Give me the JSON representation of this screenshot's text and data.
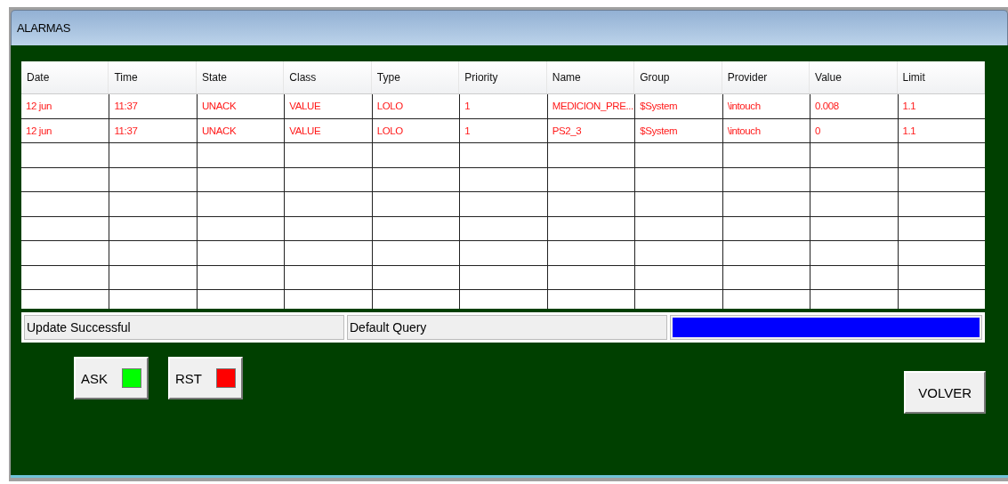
{
  "window": {
    "title": "ALARMAS"
  },
  "table": {
    "columns": [
      "Date",
      "Time",
      "State",
      "Class",
      "Type",
      "Priority",
      "Name",
      "Group",
      "Provider",
      "Value",
      "Limit"
    ],
    "rows": [
      [
        "12 jun",
        "11:37",
        "UNACK",
        "VALUE",
        "LOLO",
        "1",
        "MEDICION_PRE...",
        "$System",
        "\\intouch",
        "0.008",
        "1.1"
      ],
      [
        "12 jun",
        "11:37",
        "UNACK",
        "VALUE",
        "LOLO",
        "1",
        "PS2_3",
        "$System",
        "\\intouch",
        "0",
        "1.1"
      ]
    ]
  },
  "status_bar": {
    "message": "Update Successful",
    "query": "Default Query",
    "progress": {
      "level": 1
    }
  },
  "buttons": [
    {
      "label": "ASK",
      "color": "#00ff00"
    },
    {
      "label": "RST",
      "color": "#ff0000"
    }
  ],
  "back_button": {
    "label": "VOLVER"
  }
}
